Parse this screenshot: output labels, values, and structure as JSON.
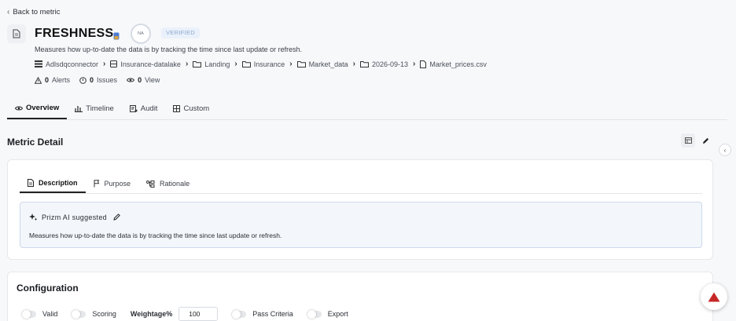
{
  "nav": {
    "back_label": "Back to metric"
  },
  "header": {
    "title": "FRESHNESS",
    "score_badge": "NA",
    "status_badge": "VERIFIED",
    "description": "Measures how up-to-date the data is by tracking the time since last update or refresh."
  },
  "breadcrumb": [
    {
      "label": "Adlsdqconnector",
      "icon": "database-list-icon"
    },
    {
      "label": "Insurance-datalake",
      "icon": "server-icon"
    },
    {
      "label": "Landing",
      "icon": "folder-icon"
    },
    {
      "label": "Insurance",
      "icon": "folder-icon"
    },
    {
      "label": "Market_data",
      "icon": "folder-icon"
    },
    {
      "label": "2026-09-13",
      "icon": "folder-icon"
    },
    {
      "label": "Market_prices.csv",
      "icon": "file-icon"
    }
  ],
  "stats": {
    "alerts_count": "0",
    "alerts_label": "Alerts",
    "issues_count": "0",
    "issues_label": "Issues",
    "views_count": "0",
    "views_label": "View"
  },
  "tabs": [
    {
      "label": "Overview",
      "active": true
    },
    {
      "label": "Timeline"
    },
    {
      "label": "Audit"
    },
    {
      "label": "Custom"
    }
  ],
  "metric_detail": {
    "title": "Metric Detail",
    "subtabs": [
      {
        "label": "Description",
        "active": true
      },
      {
        "label": "Purpose"
      },
      {
        "label": "Rationale"
      }
    ],
    "ai_label": "Prizm AI suggested",
    "ai_text": "Measures how up-to-date the data is by tracking the time since last update or refresh."
  },
  "configuration": {
    "title": "Configuration",
    "valid_label": "Valid",
    "scoring_label": "Scoring",
    "weightage_label": "Weightage%",
    "weightage_value": "100",
    "pass_criteria_label": "Pass Criteria",
    "export_label": "Export"
  },
  "colors": {
    "accent": "#c62828",
    "verified_bg": "#eaf1fb",
    "ai_box_bg": "#f3f6fb"
  }
}
